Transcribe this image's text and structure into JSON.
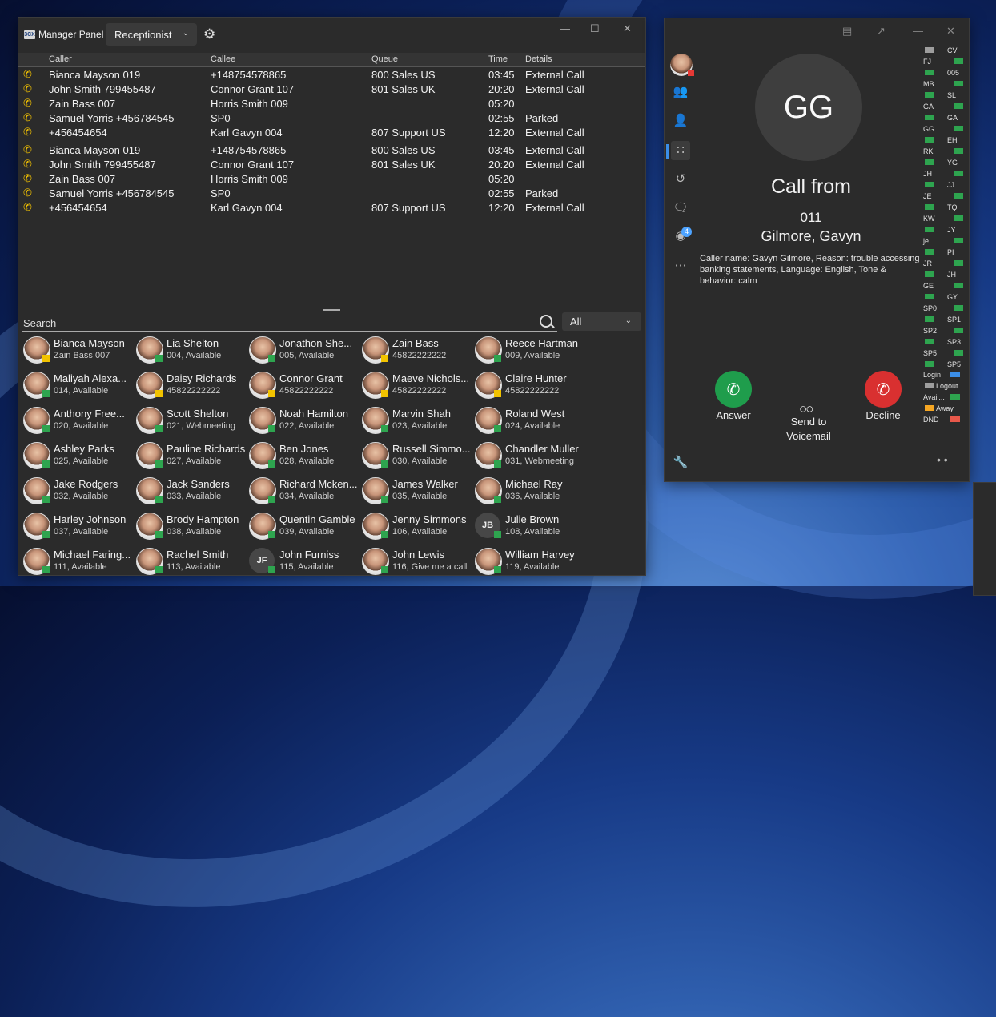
{
  "manager": {
    "title": "Manager Panel",
    "logo_text": "3CX",
    "role": "Receptionist",
    "columns": {
      "caller": "Caller",
      "callee": "Callee",
      "queue": "Queue",
      "time": "Time",
      "details": "Details"
    },
    "calls": [
      {
        "caller": "Bianca Mayson 019",
        "callee": "+148754578865",
        "queue": "800 Sales US",
        "time": "03:45",
        "details": "External Call"
      },
      {
        "caller": "John Smith 799455487",
        "callee": "Connor Grant 107",
        "queue": "801 Sales UK",
        "time": "20:20",
        "details": "External Call"
      },
      {
        "caller": "Zain Bass 007",
        "callee": "Horris Smith 009",
        "queue": "",
        "time": "05:20",
        "details": ""
      },
      {
        "caller": "Samuel Yorris +456784545",
        "callee": "SP0",
        "queue": "",
        "time": "02:55",
        "details": "Parked"
      },
      {
        "caller": "+456454654",
        "callee": "Karl Gavyn 004",
        "queue": "807 Support US",
        "time": "12:20",
        "details": "External Call"
      },
      {
        "caller": "Bianca Mayson 019",
        "callee": "+148754578865",
        "queue": "800 Sales US",
        "time": "03:45",
        "details": "External Call"
      },
      {
        "caller": "John Smith 799455487",
        "callee": "Connor Grant 107",
        "queue": "801 Sales UK",
        "time": "20:20",
        "details": "External Call"
      },
      {
        "caller": "Zain Bass 007",
        "callee": "Horris Smith 009",
        "queue": "",
        "time": "05:20",
        "details": ""
      },
      {
        "caller": "Samuel Yorris +456784545",
        "callee": "SP0",
        "queue": "",
        "time": "02:55",
        "details": "Parked"
      },
      {
        "caller": "+456454654",
        "callee": "Karl Gavyn 004",
        "queue": "807 Support US",
        "time": "12:20",
        "details": "External Call"
      }
    ],
    "search_placeholder": "Search",
    "filter": "All",
    "people": [
      {
        "name": "Bianca Mayson",
        "sub": "Zain Bass 007",
        "status": "yellow"
      },
      {
        "name": "Lia Shelton",
        "sub": "004, Available",
        "status": "green"
      },
      {
        "name": "Jonathon She...",
        "sub": "005, Available",
        "status": "green"
      },
      {
        "name": "Zain Bass",
        "sub": "45822222222",
        "status": "yellow"
      },
      {
        "name": "Reece Hartman",
        "sub": "009, Available",
        "status": "green"
      },
      {
        "name": "Maliyah Alexa...",
        "sub": "014, Available",
        "status": "green"
      },
      {
        "name": "Daisy Richards",
        "sub": "45822222222",
        "status": "yellow"
      },
      {
        "name": "Connor Grant",
        "sub": "45822222222",
        "status": "yellow"
      },
      {
        "name": "Maeve Nichols...",
        "sub": "45822222222",
        "status": "yellow"
      },
      {
        "name": "Claire Hunter",
        "sub": "45822222222",
        "status": "yellow"
      },
      {
        "name": "Anthony Free...",
        "sub": "020, Available",
        "status": "green"
      },
      {
        "name": "Scott Shelton",
        "sub": "021, Webmeeting",
        "status": "green"
      },
      {
        "name": "Noah Hamilton",
        "sub": "022, Available",
        "status": "green"
      },
      {
        "name": "Marvin Shah",
        "sub": "023, Available",
        "status": "green"
      },
      {
        "name": "Roland West",
        "sub": "024, Available",
        "status": "green"
      },
      {
        "name": "Ashley Parks",
        "sub": "025, Available",
        "status": "green"
      },
      {
        "name": "Pauline Richards",
        "sub": "027, Available",
        "status": "green"
      },
      {
        "name": "Ben Jones",
        "sub": "028, Available",
        "status": "green"
      },
      {
        "name": "Russell Simmo...",
        "sub": "030, Available",
        "status": "green"
      },
      {
        "name": "Chandler Muller",
        "sub": "031, Webmeeting",
        "status": "green"
      },
      {
        "name": "Jake Rodgers",
        "sub": "032, Available",
        "status": "green"
      },
      {
        "name": "Jack Sanders",
        "sub": "033, Available",
        "status": "green"
      },
      {
        "name": "Richard Mcken...",
        "sub": "034, Available",
        "status": "green"
      },
      {
        "name": "James Walker",
        "sub": "035, Available",
        "status": "green"
      },
      {
        "name": "Michael Ray",
        "sub": "036, Available",
        "status": "green"
      },
      {
        "name": "Harley Johnson",
        "sub": "037, Available",
        "status": "green"
      },
      {
        "name": "Brody Hampton",
        "sub": "038, Available",
        "status": "green"
      },
      {
        "name": "Quentin Gamble",
        "sub": "039, Available",
        "status": "green"
      },
      {
        "name": "Jenny Simmons",
        "sub": "106, Available",
        "status": "green"
      },
      {
        "name": "Julie Brown",
        "sub": "108, Available",
        "status": "green",
        "initials": "JB"
      },
      {
        "name": "Michael Faring...",
        "sub": "111, Available",
        "status": "green"
      },
      {
        "name": "Rachel Smith",
        "sub": "113, Available",
        "status": "green"
      },
      {
        "name": "John Furniss",
        "sub": "115, Available",
        "status": "green",
        "initials": "JF"
      },
      {
        "name": "John Lewis",
        "sub": "116, Give me a call",
        "status": "green"
      },
      {
        "name": "William Harvey",
        "sub": "119, Available",
        "status": "green"
      }
    ]
  },
  "call": {
    "initials": "GG",
    "heading": "Call from",
    "number": "011",
    "name": "Gilmore, Gavyn",
    "details": "Caller name: Gavyn Gilmore, Reason: trouble accessing banking statements, Language: English, Tone & behavior: calm",
    "answer": "Answer",
    "voicemail": "Send to Voicemail",
    "decline": "Decline",
    "badge_count": "4",
    "status_column": [
      {
        "l": "",
        "r": "CV"
      },
      {
        "l": "FJ",
        "r": ""
      },
      {
        "l": "",
        "r": "005"
      },
      {
        "l": "MB",
        "r": ""
      },
      {
        "l": "",
        "r": "SL"
      },
      {
        "l": "GA",
        "r": ""
      },
      {
        "l": "",
        "r": "GA"
      },
      {
        "l": "GG",
        "r": ""
      },
      {
        "l": "",
        "r": "EH"
      },
      {
        "l": "RK",
        "r": ""
      },
      {
        "l": "",
        "r": "YG"
      },
      {
        "l": "JH",
        "r": ""
      },
      {
        "l": "",
        "r": "JJ"
      },
      {
        "l": "JE",
        "r": ""
      },
      {
        "l": "",
        "r": "TQ"
      },
      {
        "l": "KW",
        "r": ""
      },
      {
        "l": "",
        "r": "JY"
      },
      {
        "l": "je",
        "r": ""
      },
      {
        "l": "",
        "r": "PI"
      },
      {
        "l": "JR",
        "r": ""
      },
      {
        "l": "",
        "r": "JH"
      },
      {
        "l": "GE",
        "r": ""
      },
      {
        "l": "",
        "r": "GY"
      },
      {
        "l": "SP0",
        "r": ""
      },
      {
        "l": "",
        "r": "SP1"
      },
      {
        "l": "SP2",
        "r": ""
      },
      {
        "l": "",
        "r": "SP3"
      },
      {
        "l": "SP5",
        "r": ""
      },
      {
        "l": "",
        "r": "SP5"
      }
    ],
    "legend": [
      {
        "label": "Login",
        "color": "#3b8ee8"
      },
      {
        "label": "Logout",
        "color": "#9e9e9e"
      },
      {
        "label": "Avail...",
        "color": "#2ea44f"
      },
      {
        "label": "Away",
        "color": "#f5a623"
      },
      {
        "label": "DND",
        "color": "#e8584a"
      }
    ]
  }
}
